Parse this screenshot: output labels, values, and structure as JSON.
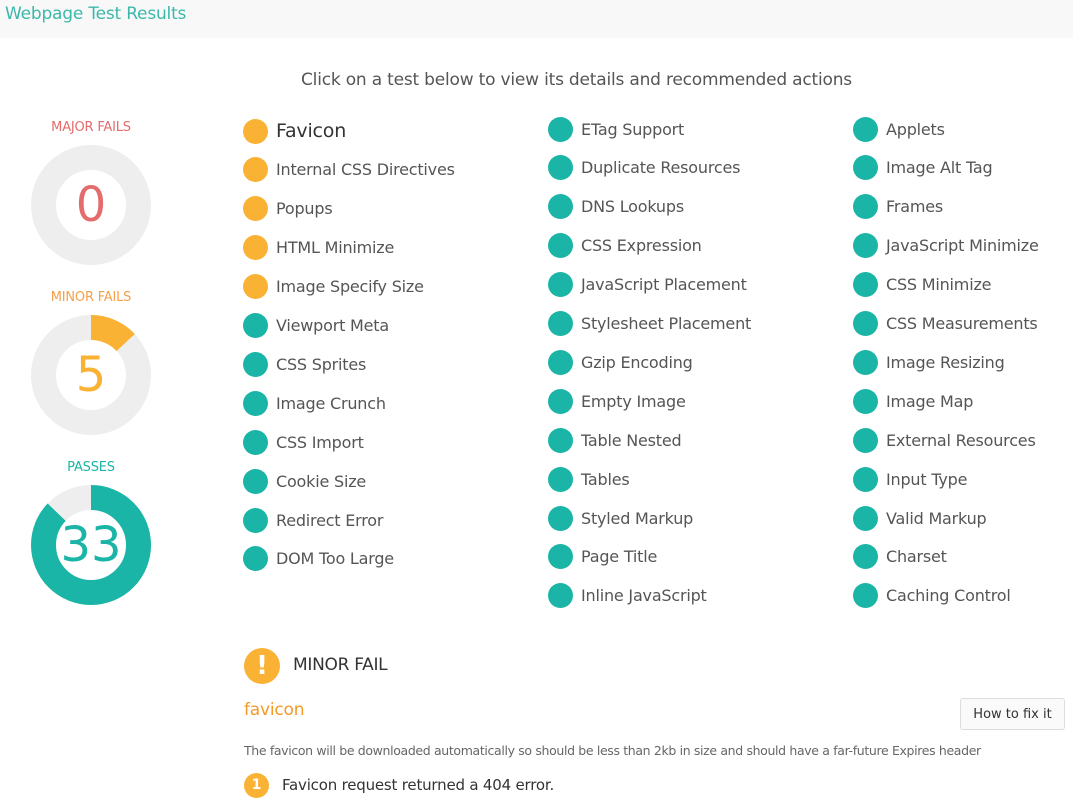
{
  "header": {
    "title": "Webpage Test Results"
  },
  "instruction": "Click on a test below to view its details and recommended actions",
  "summary": {
    "major": {
      "label": "MAJOR FAILS",
      "value": "0",
      "fraction": 0,
      "color": "#e46c6c"
    },
    "minor": {
      "label": "MINOR FAILS",
      "value": "5",
      "fraction": 0.13,
      "color": "#f9b233"
    },
    "passes": {
      "label": "PASSES",
      "value": "33",
      "fraction": 0.87,
      "color": "#1ab5a6"
    }
  },
  "colors": {
    "minor": "#f9b233",
    "pass": "#1ab5a6",
    "track": "#eeeeee"
  },
  "tests": {
    "columns": [
      [
        {
          "name": "Favicon",
          "status": "minor",
          "selected": true
        },
        {
          "name": "Internal CSS Directives",
          "status": "minor"
        },
        {
          "name": "Popups",
          "status": "minor"
        },
        {
          "name": "HTML Minimize",
          "status": "minor"
        },
        {
          "name": "Image Specify Size",
          "status": "minor"
        },
        {
          "name": "Viewport Meta",
          "status": "pass"
        },
        {
          "name": "CSS Sprites",
          "status": "pass"
        },
        {
          "name": "Image Crunch",
          "status": "pass"
        },
        {
          "name": "CSS Import",
          "status": "pass"
        },
        {
          "name": "Cookie Size",
          "status": "pass"
        },
        {
          "name": "Redirect Error",
          "status": "pass"
        },
        {
          "name": "DOM Too Large",
          "status": "pass"
        }
      ],
      [
        {
          "name": "ETag Support",
          "status": "pass"
        },
        {
          "name": "Duplicate Resources",
          "status": "pass"
        },
        {
          "name": "DNS Lookups",
          "status": "pass"
        },
        {
          "name": "CSS Expression",
          "status": "pass"
        },
        {
          "name": "JavaScript Placement",
          "status": "pass"
        },
        {
          "name": "Stylesheet Placement",
          "status": "pass"
        },
        {
          "name": "Gzip Encoding",
          "status": "pass"
        },
        {
          "name": "Empty Image",
          "status": "pass"
        },
        {
          "name": "Table Nested",
          "status": "pass"
        },
        {
          "name": "Tables",
          "status": "pass"
        },
        {
          "name": "Styled Markup",
          "status": "pass"
        },
        {
          "name": "Page Title",
          "status": "pass"
        },
        {
          "name": "Inline JavaScript",
          "status": "pass"
        }
      ],
      [
        {
          "name": "Applets",
          "status": "pass"
        },
        {
          "name": "Image Alt Tag",
          "status": "pass"
        },
        {
          "name": "Frames",
          "status": "pass"
        },
        {
          "name": "JavaScript Minimize",
          "status": "pass"
        },
        {
          "name": "CSS Minimize",
          "status": "pass"
        },
        {
          "name": "CSS Measurements",
          "status": "pass"
        },
        {
          "name": "Image Resizing",
          "status": "pass"
        },
        {
          "name": "Image Map",
          "status": "pass"
        },
        {
          "name": "External Resources",
          "status": "pass"
        },
        {
          "name": "Input Type",
          "status": "pass"
        },
        {
          "name": "Valid Markup",
          "status": "pass"
        },
        {
          "name": "Charset",
          "status": "pass"
        },
        {
          "name": "Caching Control",
          "status": "pass"
        }
      ]
    ]
  },
  "detail": {
    "icon": "exclamation-icon",
    "icon_glyph": "!",
    "status": "MINOR FAIL",
    "name": "favicon",
    "fix_label": "How to fix it",
    "description": "The favicon will be downloaded automatically so should be less than 2kb in size and should have a far-future Expires header",
    "issues": [
      {
        "number": "1",
        "text": "Favicon request returned a 404 error."
      }
    ]
  }
}
